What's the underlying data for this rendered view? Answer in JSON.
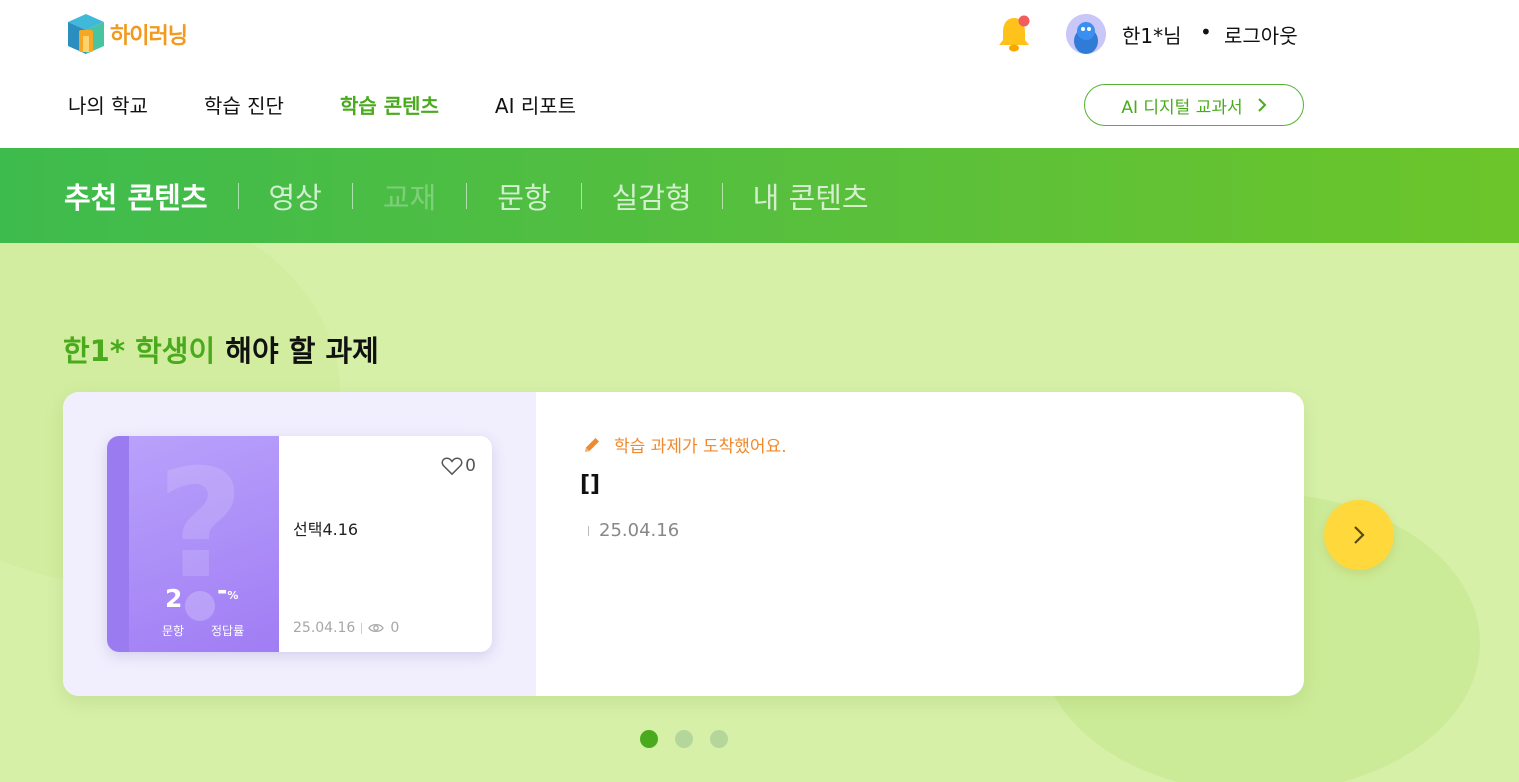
{
  "header": {
    "logo_text": "하이러닝",
    "user_name": "한1*님",
    "separator": "•",
    "logout_label": "로그아웃"
  },
  "gnb": [
    {
      "label": "나의 학교",
      "active": false
    },
    {
      "label": "학습 진단",
      "active": false
    },
    {
      "label": "학습 콘텐츠",
      "active": true
    },
    {
      "label": "AI 리포트",
      "active": false
    }
  ],
  "ai_textbook_button": {
    "label": "AI 디지털 교과서"
  },
  "tabs": [
    {
      "label": "추천 콘텐츠",
      "state": "active"
    },
    {
      "label": "영상",
      "state": "normal"
    },
    {
      "label": "교재",
      "state": "disabled"
    },
    {
      "label": "문항",
      "state": "normal"
    },
    {
      "label": "실감형",
      "state": "normal"
    },
    {
      "label": "내 콘텐츠",
      "state": "normal"
    }
  ],
  "section": {
    "title_highlight": "한1* 학생이",
    "title_rest": " 해야 할 과제"
  },
  "assignment_card": {
    "book": {
      "question_count": "2",
      "question_count_label": "문항",
      "correct_rate": "-",
      "correct_rate_unit": "%",
      "correct_rate_label": "정답률",
      "like_count": "0",
      "title": "선택4.16",
      "date": "25.04.16",
      "view_count": "0"
    },
    "notice": "학습 과제가 도착했어요.",
    "task_title": "[]",
    "task_date": "25.04.16"
  },
  "pagination": {
    "total": 3,
    "current": 1
  },
  "colors": {
    "brand_green": "#4aaa1d",
    "tab_bar_start": "#3ebb4d",
    "tab_bar_end": "#6cc52a",
    "background": "#d6f0a8",
    "book_purple": "#a07df4",
    "notice_orange": "#f08a2e",
    "next_button_yellow": "#ffd83c"
  },
  "icons": {
    "bell": "bell-icon",
    "heart": "heart-icon",
    "eye": "eye-icon",
    "pencil": "pencil-icon",
    "next": "chevron-right-icon"
  }
}
